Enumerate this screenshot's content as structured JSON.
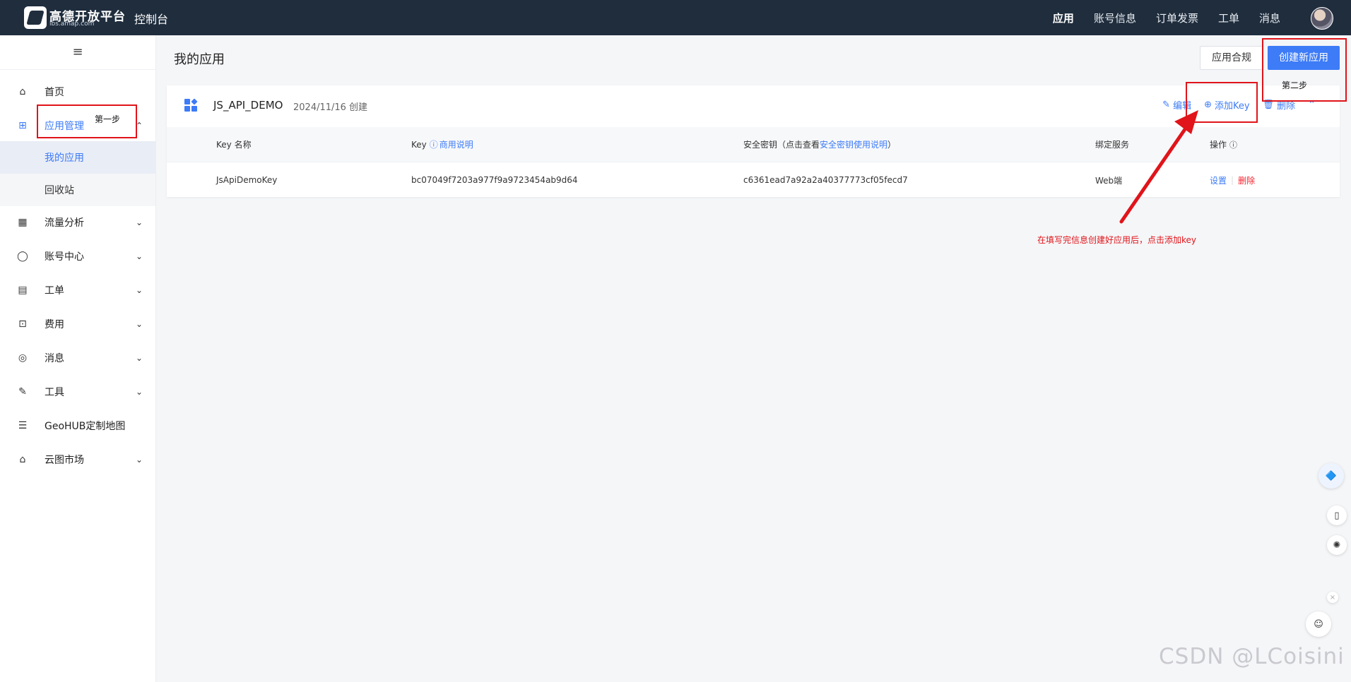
{
  "topbar": {
    "logo_text": "高德开放平台",
    "logo_sub": "lbs.amap.com",
    "console_title": "控制台",
    "nav": [
      "应用",
      "账号信息",
      "订单发票",
      "工单",
      "消息"
    ]
  },
  "sidebar": {
    "collapse_icon": "≡",
    "items": [
      {
        "label": "首页",
        "icon": "home-icon"
      },
      {
        "label": "应用管理",
        "icon": "apps-icon"
      },
      {
        "label": "流量分析",
        "icon": "chart-icon"
      },
      {
        "label": "账号中心",
        "icon": "user-icon"
      },
      {
        "label": "工单",
        "icon": "ticket-icon"
      },
      {
        "label": "费用",
        "icon": "billing-icon"
      },
      {
        "label": "消息",
        "icon": "message-icon"
      },
      {
        "label": "工具",
        "icon": "tool-icon"
      },
      {
        "label": "GeoHUB定制地图",
        "icon": "layers-icon"
      },
      {
        "label": "云图市场",
        "icon": "store-icon"
      }
    ],
    "subitems": [
      "我的应用",
      "回收站"
    ]
  },
  "main": {
    "page_title": "我的应用",
    "btn_compliance": "应用合规",
    "btn_create": "创建新应用"
  },
  "app": {
    "name": "JS_API_DEMO",
    "date": "2024/11/16 创建",
    "actions": {
      "edit": "编辑",
      "add_key": "添加Key",
      "delete": "删除"
    },
    "table": {
      "headers": {
        "key_name": "Key 名称",
        "key": "Key",
        "key_help": "商用说明",
        "secret": "安全密钥（点击查看",
        "secret_link": "安全密钥使用说明",
        "secret_end": "）",
        "service": "绑定服务",
        "ops": "操作"
      },
      "rows": [
        {
          "key_name": "JsApiDemoKey",
          "key": "bc07049f7203a977f9a9723454ab9d64",
          "secret": "c6361ead7a92a2a40377773cf05fecd7",
          "service": "Web端",
          "op_set": "设置",
          "op_delete": "删除"
        }
      ]
    }
  },
  "annotations": {
    "step1": "第一步",
    "step2": "第二步",
    "note": "在填写完信息创建好应用后，点击添加key"
  },
  "watermark": "CSDN @LCoisini",
  "colors": {
    "accent": "#3d7bf7",
    "topbar": "#1f2d3d",
    "annotation": "#e0141a"
  }
}
